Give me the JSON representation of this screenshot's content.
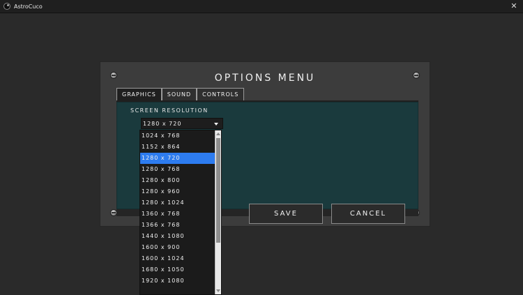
{
  "window": {
    "title": "AstroCuco",
    "close_label": "✕"
  },
  "menu": {
    "title": "Options Menu",
    "tabs": [
      {
        "label": "Graphics",
        "active": true
      },
      {
        "label": "Sound",
        "active": false
      },
      {
        "label": "Controls",
        "active": false
      }
    ]
  },
  "graphics": {
    "resolution_label": "Screen Resolution",
    "selected_value": "1280 x 720",
    "options": [
      "1024 x 768",
      "1152 x 864",
      "1280 x 720",
      "1280 x 768",
      "1280 x 800",
      "1280 x 960",
      "1280 x 1024",
      "1360 x 768",
      "1366 x 768",
      "1440 x 1080",
      "1600 x 900",
      "1600 x 1024",
      "1680 x 1050",
      "1920 x 1080"
    ],
    "selected_index": 2
  },
  "actions": {
    "save_label": "Save",
    "cancel_label": "Cancel"
  },
  "colors": {
    "content_bg": "#1a3a3d",
    "selection": "#2d7cf0",
    "panel_bg": "#3c3c3c"
  }
}
